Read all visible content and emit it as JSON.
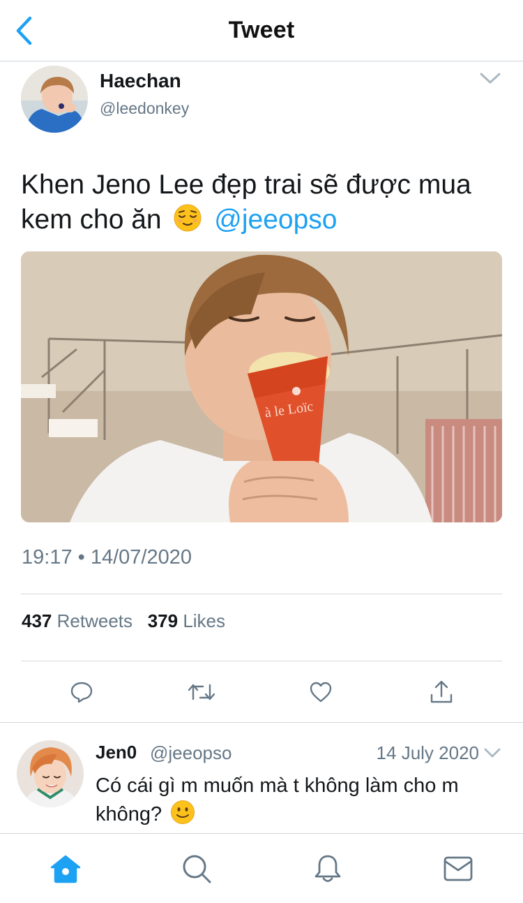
{
  "header": {
    "title": "Tweet",
    "back_icon": "chevron-left-icon"
  },
  "tweet": {
    "author": {
      "name": "Haechan",
      "handle": "@leedonkey"
    },
    "text_before": "Khen Jeno Lee đẹp trai sẽ được mua kem cho ăn",
    "emoji": "relieved-face-emoji",
    "mention": "@jeeopso",
    "timestamp": "19:17 • 14/07/2020",
    "stats": {
      "retweets_count": "437",
      "retweets_label": "Retweets",
      "likes_count": "379",
      "likes_label": "Likes"
    },
    "actions": [
      "reply-icon",
      "retweet-icon",
      "like-icon",
      "share-icon"
    ]
  },
  "reply": {
    "author": {
      "name": "Jen0",
      "handle": "@jeeopso"
    },
    "date": "14 July 2020",
    "text": "Có cái gì m muốn mà t không làm cho m không?",
    "emoji": "slightly-smiling-face-emoji"
  },
  "tabbar": {
    "items": [
      "home-icon",
      "search-icon",
      "notifications-icon",
      "messages-icon"
    ],
    "active": "home-icon"
  },
  "colors": {
    "accent": "#1da1f2",
    "secondary_text": "#657786",
    "primary_text": "#14171a",
    "divider": "#d0d6db"
  }
}
